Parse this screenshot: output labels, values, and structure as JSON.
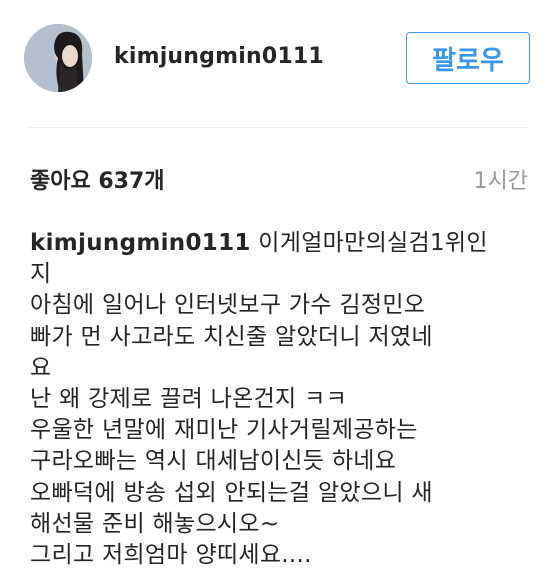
{
  "post": {
    "username": "kimjungmin0111",
    "follow_label": "팔로우",
    "likes": "좋아요 637개",
    "time": "1시간",
    "caption": {
      "username": "kimjungmin0111",
      "first_line_text": " 이게얼마만의실검1위인",
      "lines": [
        "지",
        "아침에 일어나 인터넷보구 가수 김정민오",
        "빠가 먼 사고라도 치신줄 알았더니 저였네",
        "요",
        "난 왜 강제로 끌려 나온건지 ㅋㅋ",
        "우울한 년말에 재미난 기사거릴제공하는",
        "구라오빠는 역시 대세남이신듯 하네요",
        "오빠덕에 방송 섭외 안되는걸 알았으니 새",
        "해선물 준비 해놓으시오~",
        "그리고 저희엄마 양띠세요...."
      ]
    }
  }
}
